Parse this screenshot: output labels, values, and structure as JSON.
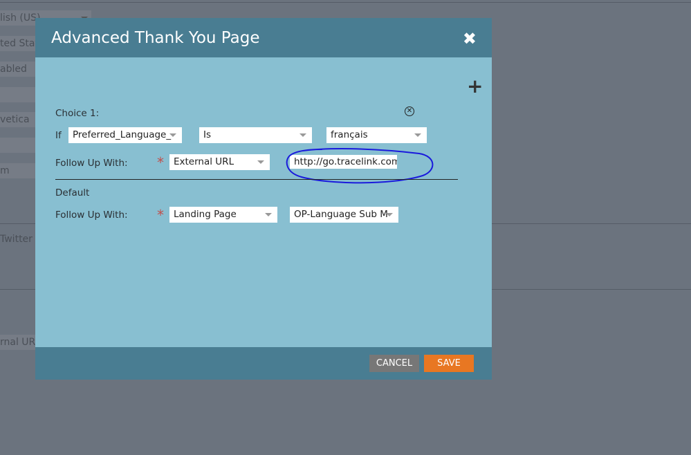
{
  "background": {
    "fields": [
      "lish (US)",
      "ted State",
      "abled",
      "",
      "vetica",
      "",
      "m"
    ],
    "twitter_label": "Twitter",
    "external_url_label": "rnal URL"
  },
  "modal": {
    "title": "Advanced Thank You Page",
    "close_icon": "close-icon",
    "add_icon": "plus-icon",
    "choice": {
      "label": "Choice 1:",
      "if_label": "If",
      "field": "Preferred_Language_",
      "operator": "Is",
      "value": "français",
      "follow_up_label": "Follow Up With:",
      "follow_up_type": "External URL",
      "url": "http://go.tracelink.com"
    },
    "default": {
      "label": "Default",
      "follow_up_label": "Follow Up With:",
      "follow_up_type": "Landing Page",
      "page": "OP-Language Sub M"
    },
    "required_mark": "*",
    "cancel_label": "CANCEL",
    "save_label": "SAVE",
    "colors": {
      "header": "#497d92",
      "body": "#88bfd1",
      "save": "#e87722",
      "cancel": "#777777",
      "annotation": "#1a1adc"
    }
  }
}
